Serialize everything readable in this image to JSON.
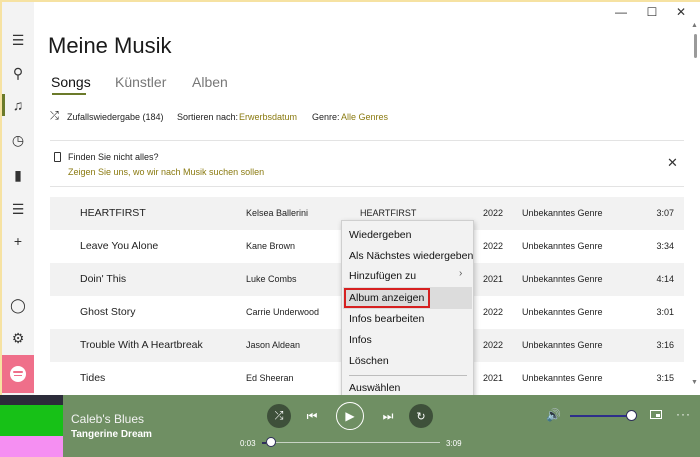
{
  "window": {
    "minimize": "—",
    "maximize": "☐",
    "close": "✕"
  },
  "sidebar": {
    "items": [
      {
        "name": "menu-icon",
        "glyph": "☰"
      },
      {
        "name": "search-icon",
        "glyph": "⚲"
      },
      {
        "name": "music-note-icon",
        "glyph": "♫"
      },
      {
        "name": "clock-icon",
        "glyph": "◷"
      },
      {
        "name": "equalizer-icon",
        "glyph": "▮"
      },
      {
        "name": "playlist-icon",
        "glyph": "☰"
      },
      {
        "name": "add-icon",
        "glyph": "+"
      },
      {
        "name": "user-icon",
        "glyph": "◯"
      },
      {
        "name": "gear-icon",
        "glyph": "⚙"
      }
    ],
    "active_color": "#6b7a2a"
  },
  "header": {
    "title": "Meine Musik"
  },
  "tabs": [
    {
      "label": "Songs",
      "active": true
    },
    {
      "label": "Künstler",
      "active": false
    },
    {
      "label": "Alben",
      "active": false
    }
  ],
  "toolbar": {
    "shuffle_label": "Zufallswiedergabe (184)",
    "sort_label": "Sortieren nach:",
    "sort_value": "Erwerbsdatum",
    "genre_label": "Genre:",
    "genre_value": "Alle Genres"
  },
  "hint": {
    "question": "Finden Sie nicht alles?",
    "link": "Zeigen Sie uns, wo wir nach Musik suchen sollen",
    "close": "✕"
  },
  "songs": [
    {
      "title": "HEARTFIRST",
      "artist": "Kelsea Ballerini",
      "album": "HEARTFIRST",
      "year": "2022",
      "genre": "Unbekanntes Genre",
      "duration": "3:07"
    },
    {
      "title": "Leave You Alone",
      "artist": "Kane Brown",
      "album": "",
      "year": "2022",
      "genre": "Unbekanntes Genre",
      "duration": "3:34"
    },
    {
      "title": "Doin' This",
      "artist": "Luke Combs",
      "album": "",
      "year": "2021",
      "genre": "Unbekanntes Genre",
      "duration": "4:14"
    },
    {
      "title": "Ghost Story",
      "artist": "Carrie Underwood",
      "album": "",
      "year": "2022",
      "genre": "Unbekanntes Genre",
      "duration": "3:01"
    },
    {
      "title": "Trouble With A Heartbreak",
      "artist": "Jason Aldean",
      "album": "",
      "year": "2022",
      "genre": "Unbekanntes Genre",
      "duration": "3:16"
    },
    {
      "title": "Tides",
      "artist": "Ed Sheeran",
      "album": "",
      "year": "2021",
      "genre": "Unbekanntes Genre",
      "duration": "3:15"
    }
  ],
  "context_menu": {
    "items": [
      {
        "label": "Wiedergeben"
      },
      {
        "label": "Als Nächstes wiedergeben"
      },
      {
        "label": "Hinzufügen zu",
        "has_submenu": true
      },
      {
        "label": "Album anzeigen",
        "highlighted": true
      },
      {
        "label": "Infos bearbeiten"
      },
      {
        "label": "Infos"
      },
      {
        "label": "Löschen"
      },
      {
        "label": "Auswählen"
      }
    ],
    "submenu_arrow": "›",
    "highlight_border": "#d62020"
  },
  "player": {
    "title": "Caleb's Blues",
    "artist": "Tangerine Dream",
    "elapsed": "0:03",
    "total": "3:09",
    "progress": 0.02,
    "volume": 0.9,
    "bg_color": "#6f8f63",
    "icons": {
      "shuffle": "⤮",
      "prev": "⏮",
      "play": "▶",
      "next": "⏭",
      "repeat": "↻",
      "volume": "🔊",
      "more": "···"
    }
  }
}
